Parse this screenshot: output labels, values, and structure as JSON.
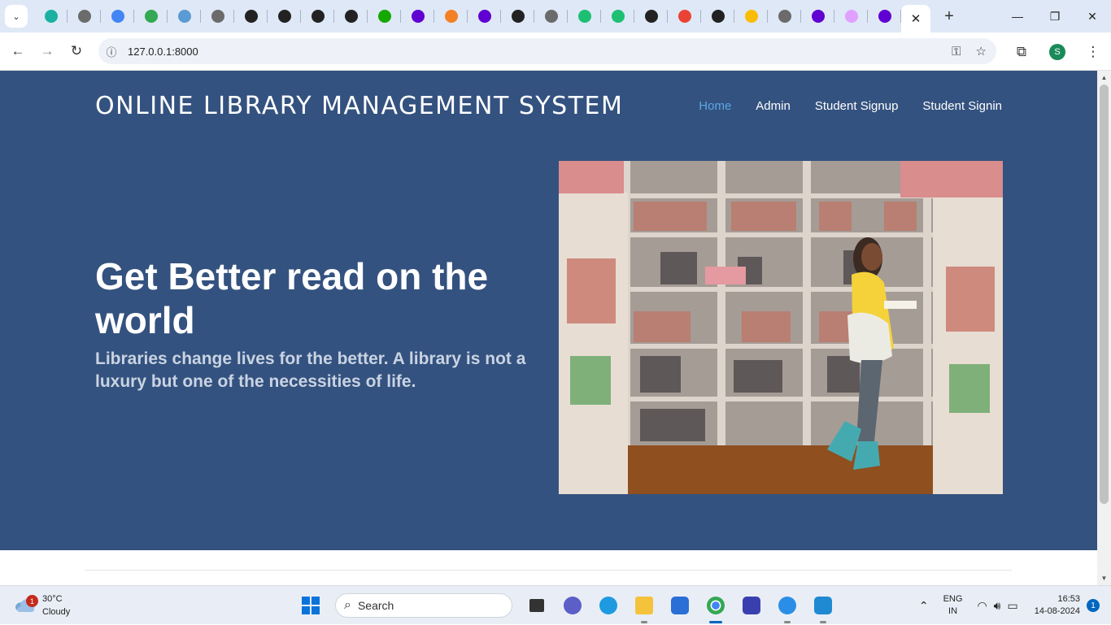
{
  "browser": {
    "tabs": [
      {
        "icon": "notion-icon",
        "color": "#1ab1a0"
      },
      {
        "icon": "globe-icon",
        "color": "#6b6b6b"
      },
      {
        "icon": "translate-icon",
        "color": "#4285f4"
      },
      {
        "icon": "badge-65-icon",
        "color": "#34a853"
      },
      {
        "icon": "bot-icon",
        "color": "#5b9bd5"
      },
      {
        "icon": "globe-icon",
        "color": "#6b6b6b"
      },
      {
        "icon": "github-icon",
        "color": "#222222"
      },
      {
        "icon": "mask-icon",
        "color": "#222222"
      },
      {
        "icon": "mask-icon",
        "color": "#222222"
      },
      {
        "icon": "github-icon",
        "color": "#222222"
      },
      {
        "icon": "upwork-icon",
        "color": "#14a800"
      },
      {
        "icon": "yahoo-icon",
        "color": "#6001d2"
      },
      {
        "icon": "stackoverflow-icon",
        "color": "#f48024"
      },
      {
        "icon": "yahoo-icon",
        "color": "#6001d2"
      },
      {
        "icon": "openai-icon",
        "color": "#222222"
      },
      {
        "icon": "globe-icon",
        "color": "#6b6b6b"
      },
      {
        "icon": "fiverr-icon",
        "color": "#1dbf73"
      },
      {
        "icon": "fiverr-icon",
        "color": "#1dbf73"
      },
      {
        "icon": "github-icon",
        "color": "#222222"
      },
      {
        "icon": "gmail-icon",
        "color": "#ea4335"
      },
      {
        "icon": "github-icon",
        "color": "#222222"
      },
      {
        "icon": "drive-icon",
        "color": "#fbbc04"
      },
      {
        "icon": "globe-icon",
        "color": "#6b6b6b"
      },
      {
        "icon": "yahoo-icon",
        "color": "#6001d2"
      },
      {
        "icon": "chrome-ring-icon",
        "color": "#e0a0ff"
      },
      {
        "icon": "yahoo-icon",
        "color": "#6001d2"
      }
    ],
    "url": "127.0.0.1:8000",
    "profile_initial": "S"
  },
  "site": {
    "brand": "ONLINE LIBRARY MANAGEMENT SYSTEM",
    "nav": [
      {
        "label": "Home",
        "active": true
      },
      {
        "label": "Admin",
        "active": false
      },
      {
        "label": "Student Signup",
        "active": false
      },
      {
        "label": "Student Signin",
        "active": false
      }
    ],
    "headline": "Get Better read on the world",
    "subline": "Libraries change lives for the better. A library is not a luxury but one of the necessities of life.",
    "illustration": "library-reading-girl-illustration",
    "colors": {
      "hero": "#34527f",
      "active_nav": "#5aa8e6"
    }
  },
  "taskbar": {
    "weather_temp": "30°C",
    "weather_desc": "Cloudy",
    "weather_badge": "1",
    "search_label": "Search",
    "lang_top": "ENG",
    "lang_bottom": "IN",
    "time": "16:53",
    "date": "14-08-2024",
    "notif_count": "1"
  }
}
